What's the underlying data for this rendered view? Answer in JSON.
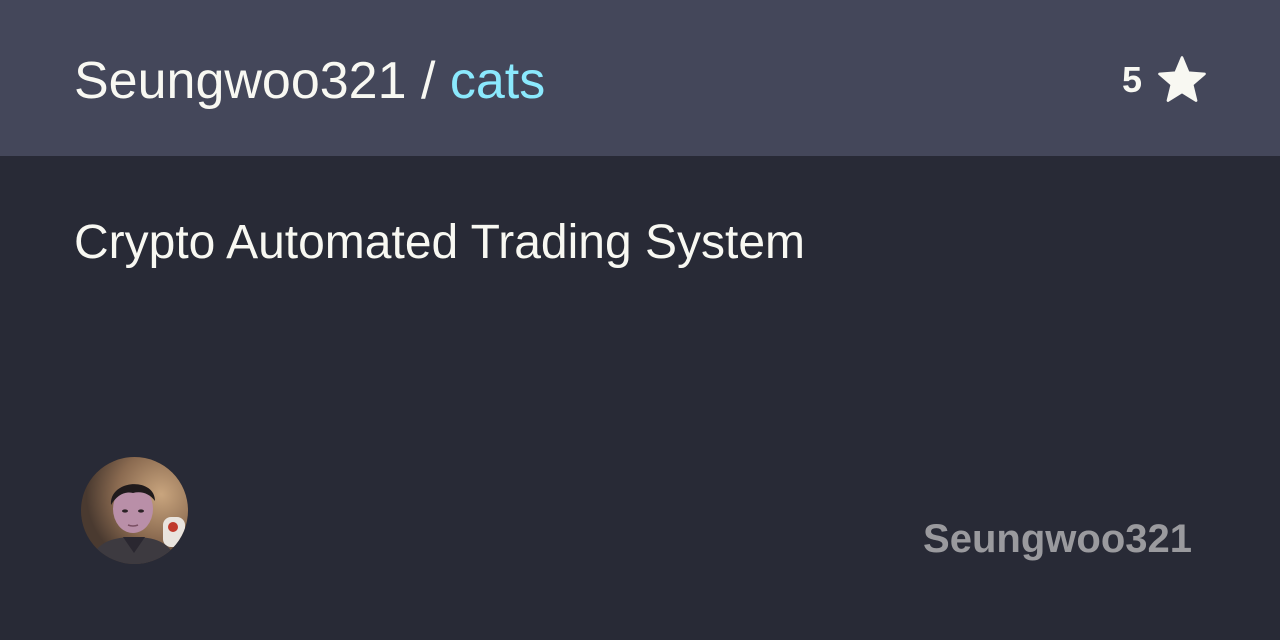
{
  "header": {
    "owner": "Seungwoo321",
    "separator": " / ",
    "repo": "cats",
    "star_count": "5",
    "star_icon": "star-icon"
  },
  "main": {
    "description": "Crypto Automated Trading System"
  },
  "footer": {
    "avatar_icon": "avatar",
    "owner_label": "Seungwoo321"
  },
  "colors": {
    "header_bg": "#44475a",
    "page_bg": "#282a36",
    "text": "#f8f8f2",
    "repo_accent": "#8be9fd",
    "owner_muted": "#9a9a9e"
  }
}
